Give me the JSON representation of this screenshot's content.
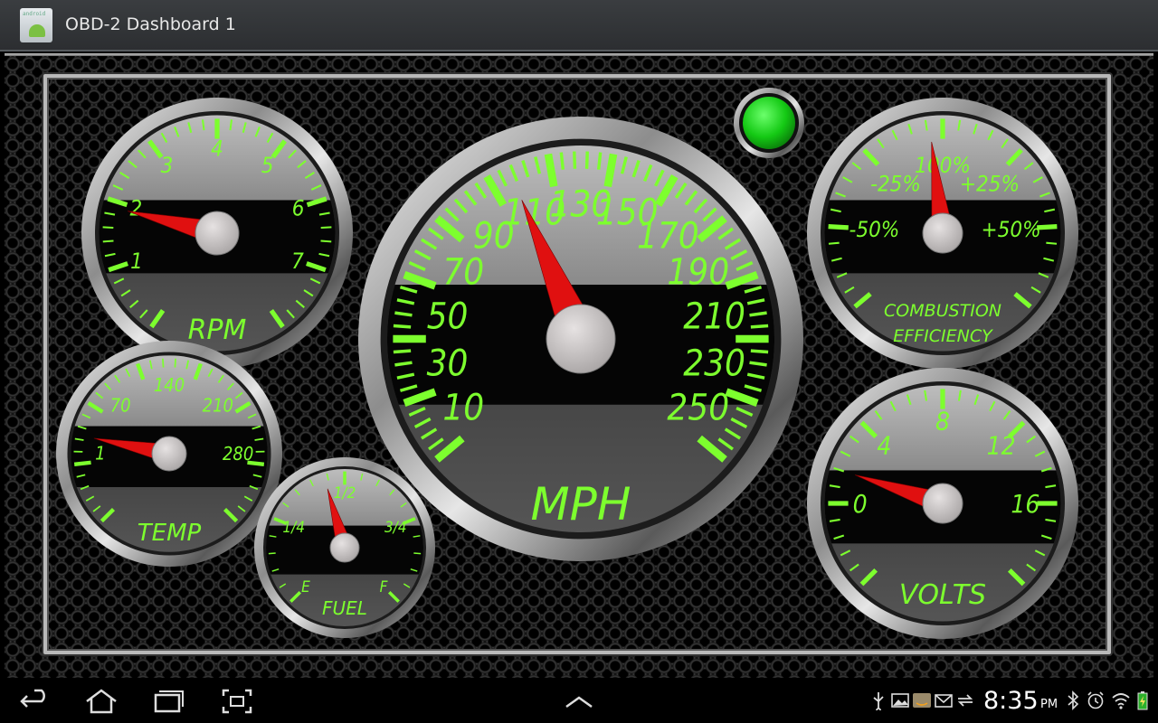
{
  "app": {
    "title": "OBD-2 Dashboard 1",
    "icon": "android-app-icon",
    "icon_text": "android"
  },
  "status_light": {
    "state": "on",
    "color": "#1ed61e"
  },
  "theme": {
    "gauge_green": "#7dff2e",
    "needle": "#e01010",
    "hub": "#c8c4c4"
  },
  "gauges": {
    "rpm": {
      "label": "RPM",
      "ticks": [
        "1",
        "2",
        "3",
        "4",
        "5",
        "6",
        "7"
      ],
      "value": 1.9
    },
    "speed": {
      "label": "MPH",
      "ticks": [
        "10",
        "30",
        "50",
        "70",
        "90",
        "110",
        "130",
        "150",
        "170",
        "190",
        "210",
        "230",
        "250"
      ],
      "value": 107
    },
    "combustion": {
      "label_line1": "COMBUSTION",
      "label_line2": "EFFICIENCY",
      "ticks": [
        "-50%",
        "-25%",
        "100%",
        "+25%",
        "+50%"
      ],
      "value": -4
    },
    "temp": {
      "label": "TEMP",
      "ticks": [
        "1",
        "70",
        "140",
        "210",
        "280"
      ],
      "value": 18
    },
    "fuel": {
      "label": "FUEL",
      "ticks": [
        "E",
        "1/4",
        "1/2",
        "3/4",
        "F"
      ],
      "value": 0.44
    },
    "volts": {
      "label": "VOLTS",
      "ticks": [
        "0",
        "4",
        "8",
        "12",
        "16"
      ],
      "value": 1.6
    }
  },
  "navbar": {
    "buttons": [
      "back-button",
      "home-button",
      "recent-apps-button",
      "screenshot-button",
      "menu-up-button"
    ]
  },
  "status_bar": {
    "time": "8:35",
    "ampm": "PM",
    "icons": [
      "usb-icon",
      "gallery-icon",
      "amazon-icon",
      "gmail-icon",
      "sync-icon",
      "bluetooth-icon",
      "alarm-icon",
      "wifi-icon",
      "battery-charging-icon"
    ]
  }
}
